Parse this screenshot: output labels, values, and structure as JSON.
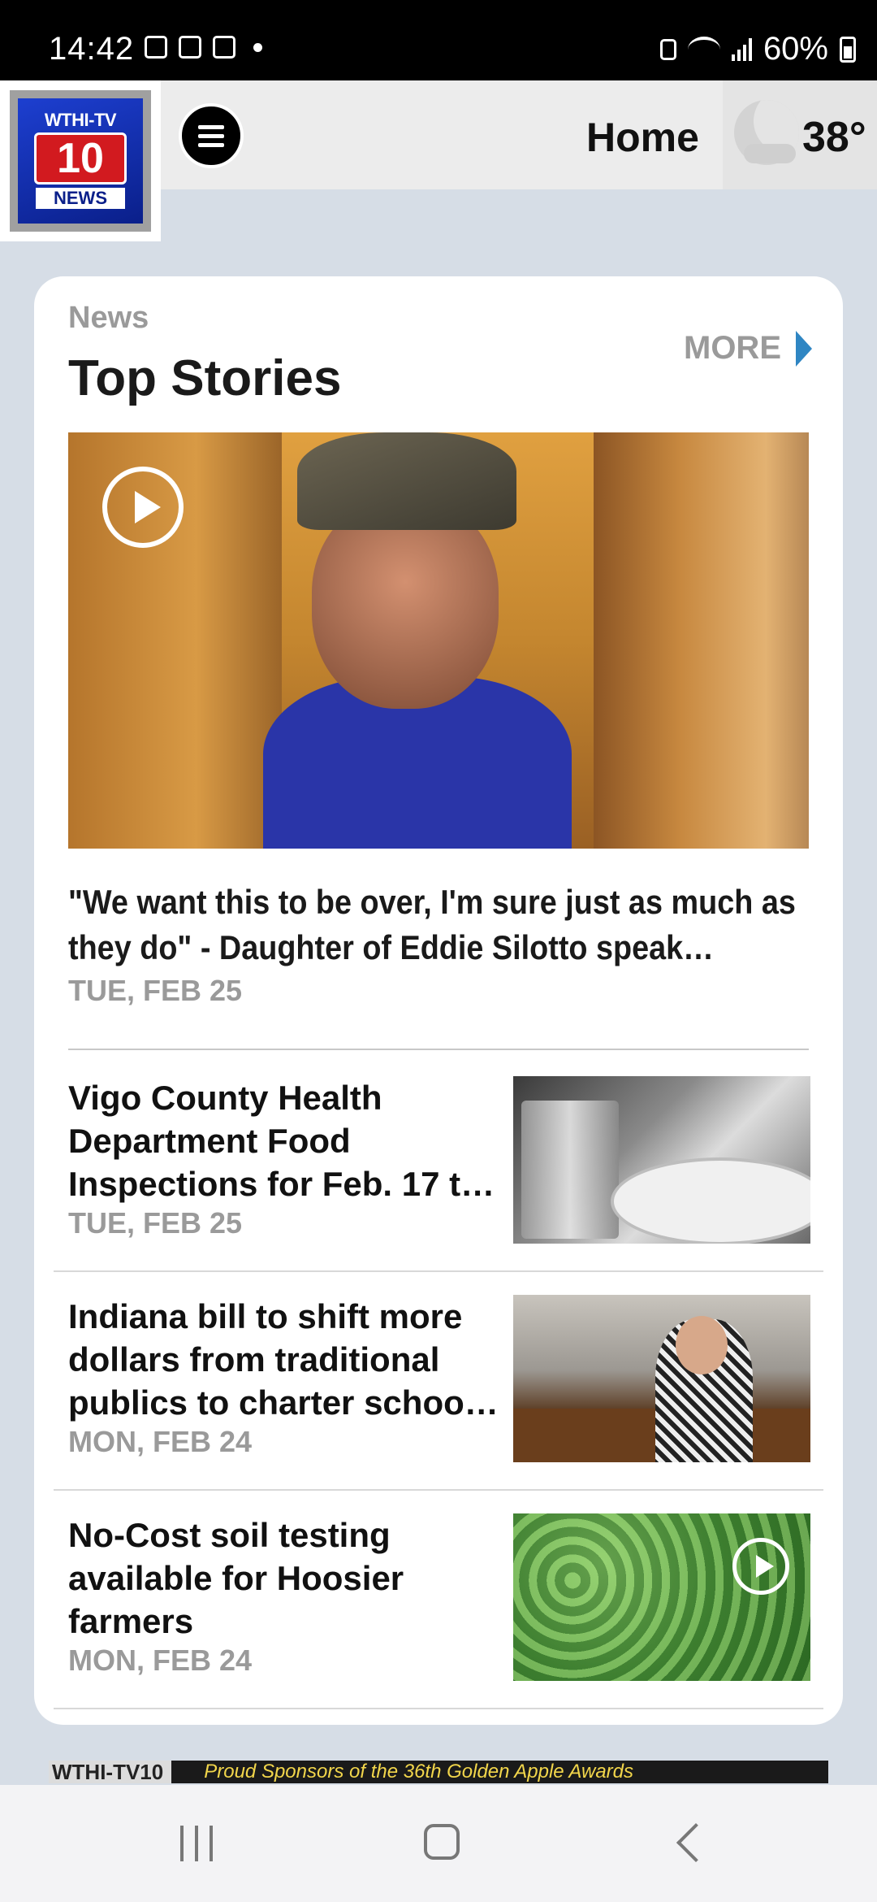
{
  "status_bar": {
    "time": "14:42",
    "battery": "60%"
  },
  "header": {
    "logo": {
      "top": "WTHI-TV",
      "number": "10",
      "bottom": "NEWS"
    },
    "title": "Home",
    "weather": {
      "temperature": "38°",
      "icon": "night-partly-cloudy-icon"
    }
  },
  "section": {
    "label": "News",
    "title": "Top Stories",
    "more": "MORE"
  },
  "hero": {
    "headline": "\"We want this to be over, I'm sure just as much as they do\" - Daughter of Eddie Silotto speak…",
    "date": "TUE, FEB 25",
    "has_video": true
  },
  "stories": [
    {
      "title": "Vigo County Health Department Food Inspections for Feb. 17 t…",
      "date": "TUE, FEB 25",
      "thumb": "dishes",
      "has_video": false
    },
    {
      "title": "Indiana bill to shift more dollars from traditional publics to charter schoo…",
      "date": "MON, FEB 24",
      "thumb": "senate",
      "has_video": false
    },
    {
      "title": "No-Cost soil testing available for Hoosier farmers",
      "date": "MON, FEB 24",
      "thumb": "field",
      "has_video": true
    }
  ],
  "banner": {
    "logo": "WTHI-TV10",
    "text": "Proud Sponsors of the 36th Golden Apple Awards"
  },
  "colors": {
    "accent": "#2f86c3",
    "background": "#d6dde6"
  }
}
